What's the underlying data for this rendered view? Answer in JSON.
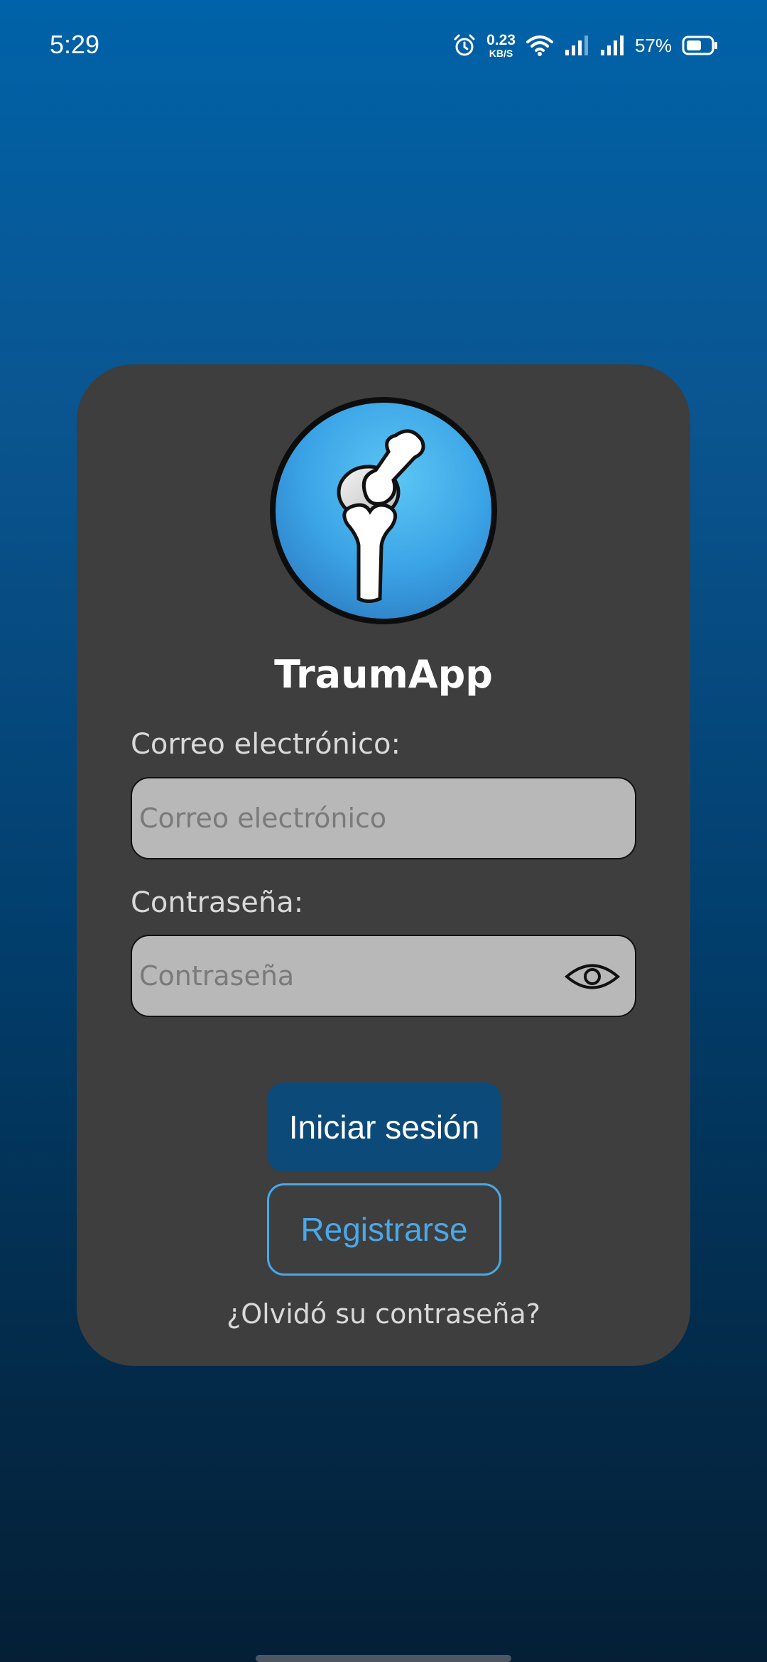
{
  "status_bar": {
    "time": "5:29",
    "net_speed_value": "0.23",
    "net_speed_unit": "KB/S",
    "battery_percent": "57%",
    "icons": [
      "alarm-icon",
      "wifi-icon",
      "signal-icon",
      "signal-icon",
      "battery-icon"
    ]
  },
  "login": {
    "app_title": "TraumApp",
    "email_label": "Correo electrónico:",
    "email_placeholder": "Correo electrónico",
    "email_value": "",
    "password_label": "Contraseña:",
    "password_placeholder": "Contraseña",
    "password_value": "",
    "login_button": "Iniciar sesión",
    "register_button": "Registrarse",
    "forgot_password": "¿Olvidó su contraseña?"
  },
  "colors": {
    "card_background": "#3e3e3e",
    "primary_button": "#0c4a7a",
    "accent": "#4aa8e8",
    "input_background": "#b8b8b8"
  }
}
